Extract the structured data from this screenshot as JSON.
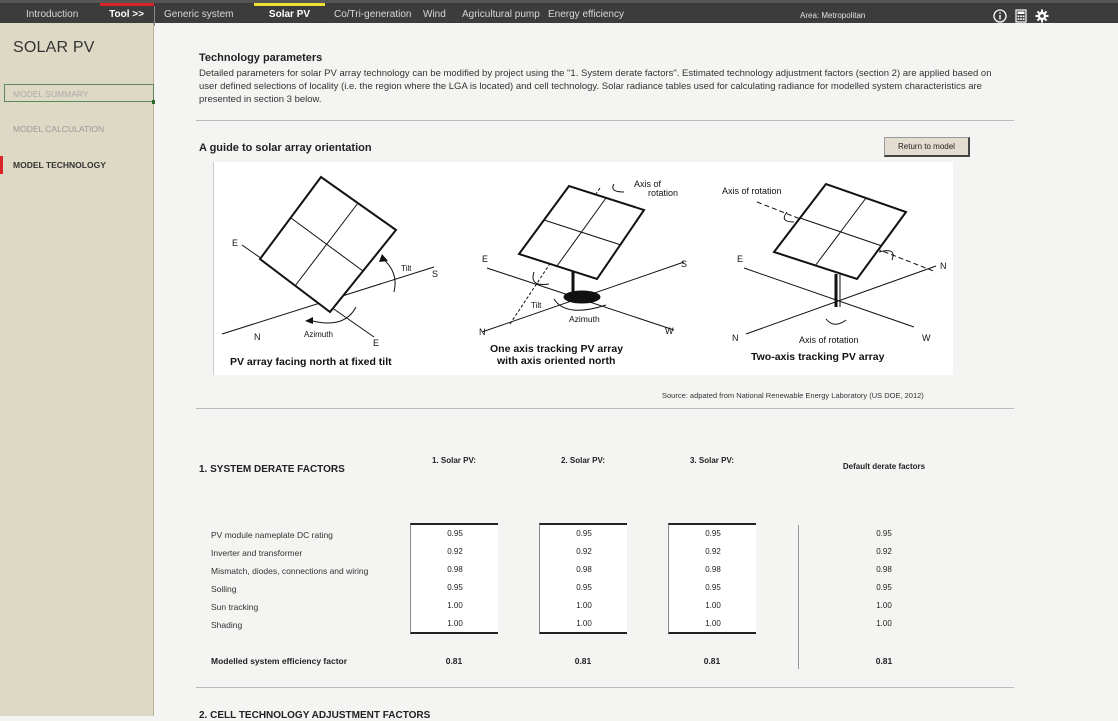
{
  "nav": {
    "tabs": [
      {
        "label": "Introduction"
      },
      {
        "label": "Tool >>"
      },
      {
        "label": "Generic system"
      },
      {
        "label": "Solar PV"
      },
      {
        "label": "Co/Tri-generation"
      },
      {
        "label": "Wind"
      },
      {
        "label": "Agricultural pump"
      },
      {
        "label": "Energy efficiency"
      }
    ],
    "area": "Area: Metropolitan",
    "icons": [
      "info-icon",
      "calculator-icon",
      "gear-icon"
    ],
    "colors": {
      "tool_mark": "#d9252a",
      "solar_mark": "#f0e030"
    }
  },
  "sidebar": {
    "title": "SOLAR PV",
    "items": [
      {
        "label": "MODEL SUMMARY"
      },
      {
        "label": "MODEL CALCULATION"
      },
      {
        "label": "MODEL TECHNOLOGY"
      }
    ]
  },
  "tech": {
    "heading": "Technology parameters",
    "description": "Detailed parameters for solar PV array technology can be modified by project using the \"1. System derate factors\".  Estimated technology adjustment factors (section 2) are applied based on user defined selections of locality (i.e. the region where the LGA is located) and cell technology. Solar radiance tables used for calculating radiance for modelled system characteristics are presented in section 3 below."
  },
  "guide": {
    "heading": "A guide to solar array orientation",
    "return_button": "Return to model",
    "diagram": {
      "panel1": {
        "caption": "PV array facing north at fixed tilt",
        "labels": [
          "E",
          "S",
          "N",
          "E",
          "Tilt",
          "Azimuth"
        ]
      },
      "panel2": {
        "caption_line1": "One axis tracking PV array",
        "caption_line2": "with axis oriented north",
        "labels": [
          "Axis of",
          "rotation",
          "E",
          "S",
          "N",
          "W",
          "Tilt",
          "Azimuth"
        ]
      },
      "panel3": {
        "caption": "Two-axis tracking PV array",
        "labels": [
          "Axis of rotation",
          "E",
          "N",
          "N",
          "W",
          "Axis of rotation"
        ]
      }
    },
    "source": "Source: adpated from National Renewable Energy Laboratory (US DOE, 2012)"
  },
  "derate": {
    "heading": "1. SYSTEM DERATE FACTORS",
    "columns": [
      "1. Solar PV:",
      "2. Solar PV:",
      "3. Solar PV:",
      "Default derate factors"
    ],
    "rows": [
      {
        "label": "PV module nameplate DC rating",
        "values": [
          "0.95",
          "0.95",
          "0.95"
        ],
        "default": "0.95"
      },
      {
        "label": "Inverter and transformer",
        "values": [
          "0.92",
          "0.92",
          "0.92"
        ],
        "default": "0.92"
      },
      {
        "label": "Mismatch, diodes, connections and wiring",
        "values": [
          "0.98",
          "0.98",
          "0.98"
        ],
        "default": "0.98"
      },
      {
        "label": "Soiling",
        "values": [
          "0.95",
          "0.95",
          "0.95"
        ],
        "default": "0.95"
      },
      {
        "label": "Sun tracking",
        "values": [
          "1.00",
          "1.00",
          "1.00"
        ],
        "default": "1.00"
      },
      {
        "label": "Shading",
        "values": [
          "1.00",
          "1.00",
          "1.00"
        ],
        "default": "1.00"
      }
    ],
    "total": {
      "label": "Modelled system efficiency factor",
      "values": [
        "0.81",
        "0.81",
        "0.81"
      ],
      "default": "0.81"
    }
  },
  "cell": {
    "heading": "2. CELL TECHNOLOGY ADJUSTMENT FACTORS"
  }
}
